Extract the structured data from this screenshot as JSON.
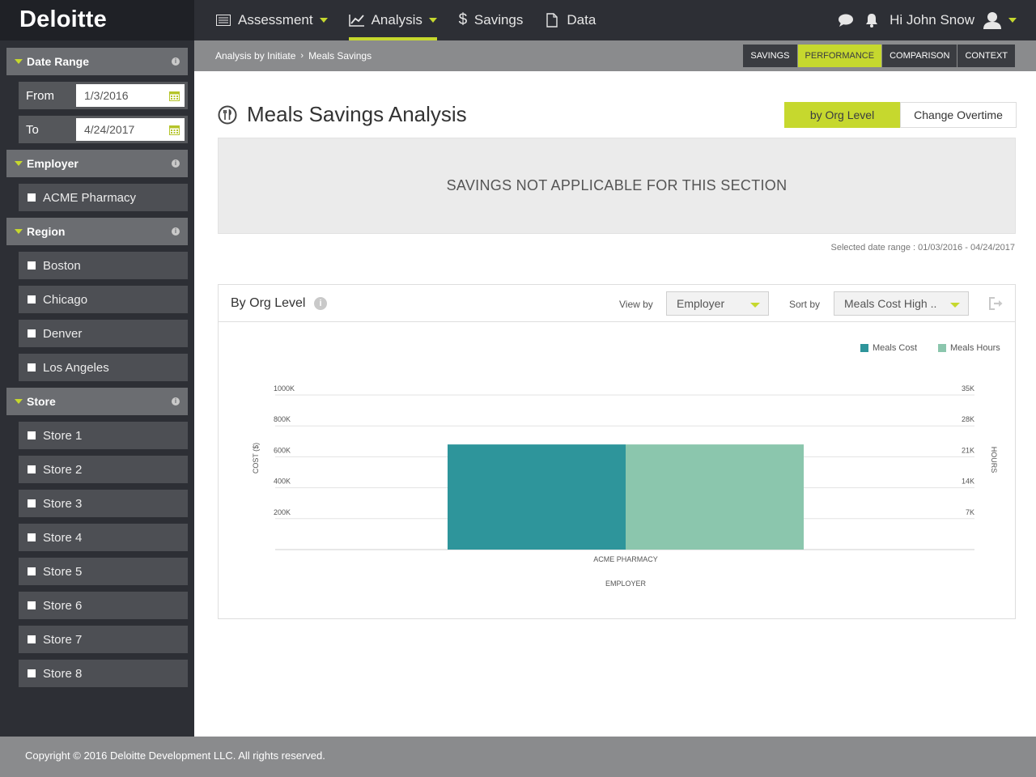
{
  "brand": "Deloitte",
  "nav": {
    "items": [
      {
        "label": "Assessment"
      },
      {
        "label": "Analysis"
      },
      {
        "label": "Savings"
      },
      {
        "label": "Data"
      }
    ],
    "greeting": "Hi John Snow"
  },
  "sidebar": {
    "date_range": {
      "title": "Date Range",
      "from_label": "From",
      "from_value": "1/3/2016",
      "to_label": "To",
      "to_value": "4/24/2017"
    },
    "employer": {
      "title": "Employer",
      "items": [
        "ACME Pharmacy"
      ]
    },
    "region": {
      "title": "Region",
      "items": [
        "Boston",
        "Chicago",
        "Denver",
        "Los Angeles"
      ]
    },
    "store": {
      "title": "Store",
      "items": [
        "Store 1",
        "Store 2",
        "Store 3",
        "Store 4",
        "Store 5",
        "Store 6",
        "Store 7",
        "Store 8"
      ]
    }
  },
  "breadcrumb": {
    "parent": "Analysis by Initiate",
    "sep": "›",
    "current": "Meals Savings"
  },
  "tabs": [
    {
      "label": "SAVINGS",
      "active": false
    },
    {
      "label": "PERFORMANCE",
      "active": true
    },
    {
      "label": "COMPARISON",
      "active": false
    },
    {
      "label": "CONTEXT",
      "active": false
    }
  ],
  "main": {
    "title": "Meals Savings Analysis",
    "toggle_on": "by Org Level",
    "toggle_off": "Change Overtime",
    "notice": "SAVINGS NOT APPLICABLE FOR THIS SECTION",
    "range_note": "Selected date range : 01/03/2016 - 04/24/2017"
  },
  "panel": {
    "title": "By Org Level",
    "view_by_label": "View by",
    "view_by_value": "Employer",
    "sort_by_label": "Sort by",
    "sort_by_value": "Meals Cost High .."
  },
  "colors": {
    "accent": "#c6d82e",
    "cost": "#2e959b",
    "hours": "#8bc6ad"
  },
  "chart_data": {
    "type": "bar",
    "categories": [
      "ACME PHARMACY"
    ],
    "series": [
      {
        "name": "Meals Cost",
        "axis": "left",
        "values": [
          680000
        ]
      },
      {
        "name": "Meals Hours",
        "axis": "right",
        "values": [
          23800
        ]
      }
    ],
    "xlabel": "EMPLOYER",
    "ylabel": "COST ($)",
    "y2label": "HOURS",
    "ylim": [
      0,
      1000000
    ],
    "y2lim": [
      0,
      35000
    ],
    "yticks": [
      "200K",
      "400K",
      "600K",
      "800K",
      "1000K"
    ],
    "y2ticks": [
      "7K",
      "14K",
      "21K",
      "28K",
      "35K"
    ],
    "legend": "top-right",
    "grid": true
  }
}
